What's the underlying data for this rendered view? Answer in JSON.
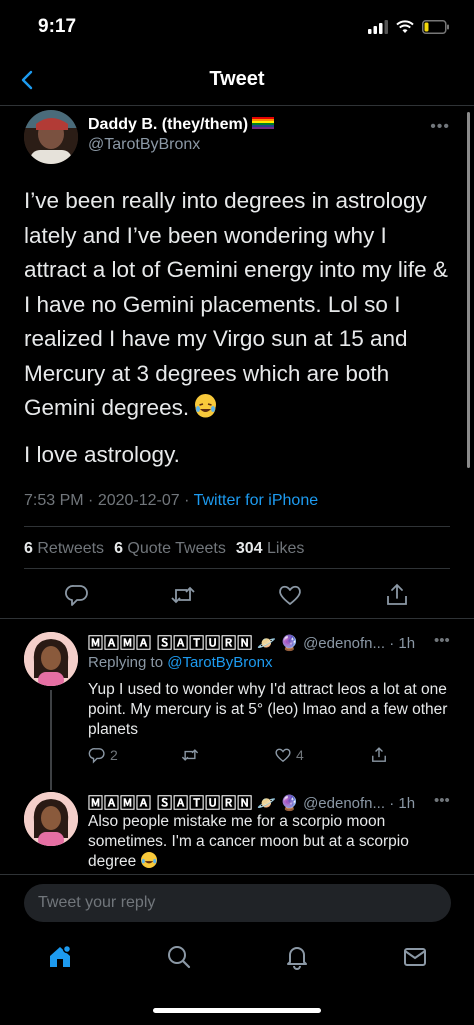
{
  "status_bar": {
    "time": "9:17"
  },
  "nav": {
    "title": "Tweet"
  },
  "main_tweet": {
    "author_name": "Daddy B. (they/them)",
    "author_handle": "@TarotByBronx",
    "body_p1": "I’ve been really into degrees in astrology lately and I’ve been wondering why I attract a lot of Gemini energy into my life & I have no Gemini placements. Lol so I realized I have my Virgo sun at 15 and Mercury at 3 degrees which are both Gemini degrees.",
    "body_p2": "I love astrology.",
    "time": "7:53 PM",
    "date": "2020-12-07",
    "source": "Twitter for iPhone",
    "retweets_count": "6",
    "retweets_label": "Retweets",
    "quotes_count": "6",
    "quotes_label": "Quote Tweets",
    "likes_count": "304",
    "likes_label": "Likes"
  },
  "replies": [
    {
      "name": "🄼🄰🄼🄰 🅂🄰🅃🅄🅁🄽",
      "handle": "@edenofn...",
      "time": "1h",
      "replying_prefix": "Replying to",
      "replying_to": "@TarotByBronx",
      "text": "Yup I used to wonder why I'd attract leos a lot at one point. My mercury is at 5° (leo) lmao and a few other planets",
      "reply_count": "2",
      "like_count": "4"
    },
    {
      "name": "🄼🄰🄼🄰 🅂🄰🅃🅄🅁🄽",
      "handle": "@edenofn...",
      "time": "1h",
      "text": "Also people mistake me for a scorpio moon sometimes. I'm a cancer moon but at a scorpio degree"
    }
  ],
  "compose": {
    "placeholder": "Tweet your reply"
  },
  "icons": {
    "back": "chevron-left-icon",
    "reply": "reply-icon",
    "retweet": "retweet-icon",
    "like": "heart-icon",
    "share": "share-icon",
    "home": "home-icon",
    "search": "search-icon",
    "notifications": "bell-icon",
    "messages": "mail-icon"
  },
  "colors": {
    "accent": "#1d9bf0",
    "background": "#000000",
    "muted": "#71767b"
  }
}
